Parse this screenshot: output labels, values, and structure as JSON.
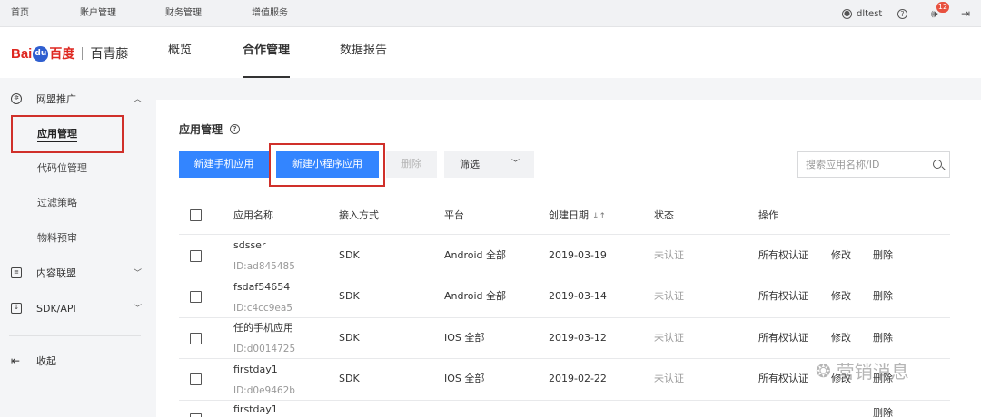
{
  "topbar": {
    "nav": [
      "首页",
      "账户管理",
      "财务管理",
      "增值服务"
    ],
    "username": "dltest",
    "notification_count": "12"
  },
  "header": {
    "logo": {
      "bai": "Bai",
      "du": "du",
      "cn": "百度",
      "product": "百青藤"
    },
    "nav": [
      {
        "label": "概览",
        "active": false
      },
      {
        "label": "合作管理",
        "active": true
      },
      {
        "label": "数据报告",
        "active": false
      }
    ]
  },
  "sidebar": {
    "groups": [
      {
        "label": "网盟推广",
        "expanded": true,
        "items": [
          "应用管理",
          "代码位管理",
          "过滤策略",
          "物料预审"
        ],
        "active_item": "应用管理"
      },
      {
        "label": "内容联盟",
        "expanded": false
      },
      {
        "label": "SDK/API",
        "expanded": false
      }
    ],
    "collapse_label": "收起"
  },
  "main": {
    "title": "应用管理",
    "buttons": {
      "new_mobile_app": "新建手机应用",
      "new_mini_program": "新建小程序应用",
      "delete": "删除",
      "filter": "筛选"
    },
    "search_placeholder": "搜索应用名称/ID",
    "table": {
      "headers": [
        "应用名称",
        "接入方式",
        "平台",
        "创建日期",
        "状态",
        "操作"
      ],
      "rows": [
        {
          "name": "sdsser",
          "id": "ID:ad845485",
          "access": "SDK",
          "platform": "Android 全部",
          "date": "2019-03-19",
          "status": "未认证",
          "actions": [
            "所有权认证",
            "修改",
            "删除"
          ]
        },
        {
          "name": "fsdaf54654",
          "id": "ID:c4cc9ea5",
          "access": "SDK",
          "platform": "Android 全部",
          "date": "2019-03-14",
          "status": "未认证",
          "actions": [
            "所有权认证",
            "修改",
            "删除"
          ]
        },
        {
          "name": "任的手机应用",
          "id": "ID:d0014725",
          "access": "SDK",
          "platform": "IOS 全部",
          "date": "2019-03-12",
          "status": "未认证",
          "actions": [
            "所有权认证",
            "修改",
            "删除"
          ]
        },
        {
          "name": "firstday1",
          "id": "ID:d0e9462b",
          "access": "SDK",
          "platform": "IOS 全部",
          "date": "2019-02-22",
          "status": "未认证",
          "actions": [
            "所有权认证",
            "修改",
            "删除"
          ]
        },
        {
          "name": "firstday1",
          "id": "",
          "access": "",
          "platform": "",
          "date": "",
          "status": "",
          "actions": [
            "",
            "",
            "删除"
          ]
        }
      ]
    }
  },
  "watermark": "营销消息",
  "colors": {
    "primary": "#3385ff",
    "highlight": "#d0302a",
    "brand_red": "#de2821",
    "brand_blue": "#2f5fd0"
  }
}
